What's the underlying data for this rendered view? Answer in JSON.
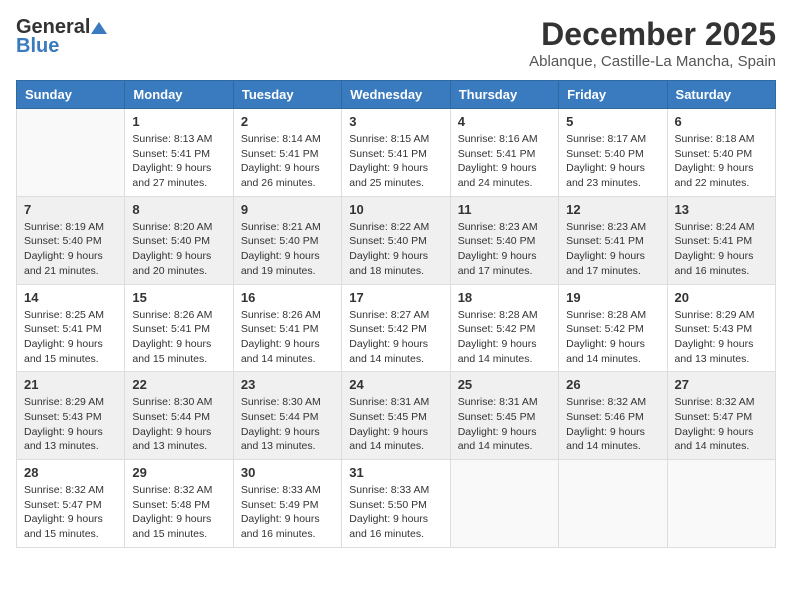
{
  "header": {
    "logo_general": "General",
    "logo_blue": "Blue",
    "month_title": "December 2025",
    "location": "Ablanque, Castille-La Mancha, Spain"
  },
  "weekdays": [
    "Sunday",
    "Monday",
    "Tuesday",
    "Wednesday",
    "Thursday",
    "Friday",
    "Saturday"
  ],
  "weeks": [
    [
      {
        "day": "",
        "info": ""
      },
      {
        "day": "1",
        "info": "Sunrise: 8:13 AM\nSunset: 5:41 PM\nDaylight: 9 hours\nand 27 minutes."
      },
      {
        "day": "2",
        "info": "Sunrise: 8:14 AM\nSunset: 5:41 PM\nDaylight: 9 hours\nand 26 minutes."
      },
      {
        "day": "3",
        "info": "Sunrise: 8:15 AM\nSunset: 5:41 PM\nDaylight: 9 hours\nand 25 minutes."
      },
      {
        "day": "4",
        "info": "Sunrise: 8:16 AM\nSunset: 5:41 PM\nDaylight: 9 hours\nand 24 minutes."
      },
      {
        "day": "5",
        "info": "Sunrise: 8:17 AM\nSunset: 5:40 PM\nDaylight: 9 hours\nand 23 minutes."
      },
      {
        "day": "6",
        "info": "Sunrise: 8:18 AM\nSunset: 5:40 PM\nDaylight: 9 hours\nand 22 minutes."
      }
    ],
    [
      {
        "day": "7",
        "info": "Sunrise: 8:19 AM\nSunset: 5:40 PM\nDaylight: 9 hours\nand 21 minutes."
      },
      {
        "day": "8",
        "info": "Sunrise: 8:20 AM\nSunset: 5:40 PM\nDaylight: 9 hours\nand 20 minutes."
      },
      {
        "day": "9",
        "info": "Sunrise: 8:21 AM\nSunset: 5:40 PM\nDaylight: 9 hours\nand 19 minutes."
      },
      {
        "day": "10",
        "info": "Sunrise: 8:22 AM\nSunset: 5:40 PM\nDaylight: 9 hours\nand 18 minutes."
      },
      {
        "day": "11",
        "info": "Sunrise: 8:23 AM\nSunset: 5:40 PM\nDaylight: 9 hours\nand 17 minutes."
      },
      {
        "day": "12",
        "info": "Sunrise: 8:23 AM\nSunset: 5:41 PM\nDaylight: 9 hours\nand 17 minutes."
      },
      {
        "day": "13",
        "info": "Sunrise: 8:24 AM\nSunset: 5:41 PM\nDaylight: 9 hours\nand 16 minutes."
      }
    ],
    [
      {
        "day": "14",
        "info": "Sunrise: 8:25 AM\nSunset: 5:41 PM\nDaylight: 9 hours\nand 15 minutes."
      },
      {
        "day": "15",
        "info": "Sunrise: 8:26 AM\nSunset: 5:41 PM\nDaylight: 9 hours\nand 15 minutes."
      },
      {
        "day": "16",
        "info": "Sunrise: 8:26 AM\nSunset: 5:41 PM\nDaylight: 9 hours\nand 14 minutes."
      },
      {
        "day": "17",
        "info": "Sunrise: 8:27 AM\nSunset: 5:42 PM\nDaylight: 9 hours\nand 14 minutes."
      },
      {
        "day": "18",
        "info": "Sunrise: 8:28 AM\nSunset: 5:42 PM\nDaylight: 9 hours\nand 14 minutes."
      },
      {
        "day": "19",
        "info": "Sunrise: 8:28 AM\nSunset: 5:42 PM\nDaylight: 9 hours\nand 14 minutes."
      },
      {
        "day": "20",
        "info": "Sunrise: 8:29 AM\nSunset: 5:43 PM\nDaylight: 9 hours\nand 13 minutes."
      }
    ],
    [
      {
        "day": "21",
        "info": "Sunrise: 8:29 AM\nSunset: 5:43 PM\nDaylight: 9 hours\nand 13 minutes."
      },
      {
        "day": "22",
        "info": "Sunrise: 8:30 AM\nSunset: 5:44 PM\nDaylight: 9 hours\nand 13 minutes."
      },
      {
        "day": "23",
        "info": "Sunrise: 8:30 AM\nSunset: 5:44 PM\nDaylight: 9 hours\nand 13 minutes."
      },
      {
        "day": "24",
        "info": "Sunrise: 8:31 AM\nSunset: 5:45 PM\nDaylight: 9 hours\nand 14 minutes."
      },
      {
        "day": "25",
        "info": "Sunrise: 8:31 AM\nSunset: 5:45 PM\nDaylight: 9 hours\nand 14 minutes."
      },
      {
        "day": "26",
        "info": "Sunrise: 8:32 AM\nSunset: 5:46 PM\nDaylight: 9 hours\nand 14 minutes."
      },
      {
        "day": "27",
        "info": "Sunrise: 8:32 AM\nSunset: 5:47 PM\nDaylight: 9 hours\nand 14 minutes."
      }
    ],
    [
      {
        "day": "28",
        "info": "Sunrise: 8:32 AM\nSunset: 5:47 PM\nDaylight: 9 hours\nand 15 minutes."
      },
      {
        "day": "29",
        "info": "Sunrise: 8:32 AM\nSunset: 5:48 PM\nDaylight: 9 hours\nand 15 minutes."
      },
      {
        "day": "30",
        "info": "Sunrise: 8:33 AM\nSunset: 5:49 PM\nDaylight: 9 hours\nand 16 minutes."
      },
      {
        "day": "31",
        "info": "Sunrise: 8:33 AM\nSunset: 5:50 PM\nDaylight: 9 hours\nand 16 minutes."
      },
      {
        "day": "",
        "info": ""
      },
      {
        "day": "",
        "info": ""
      },
      {
        "day": "",
        "info": ""
      }
    ]
  ]
}
